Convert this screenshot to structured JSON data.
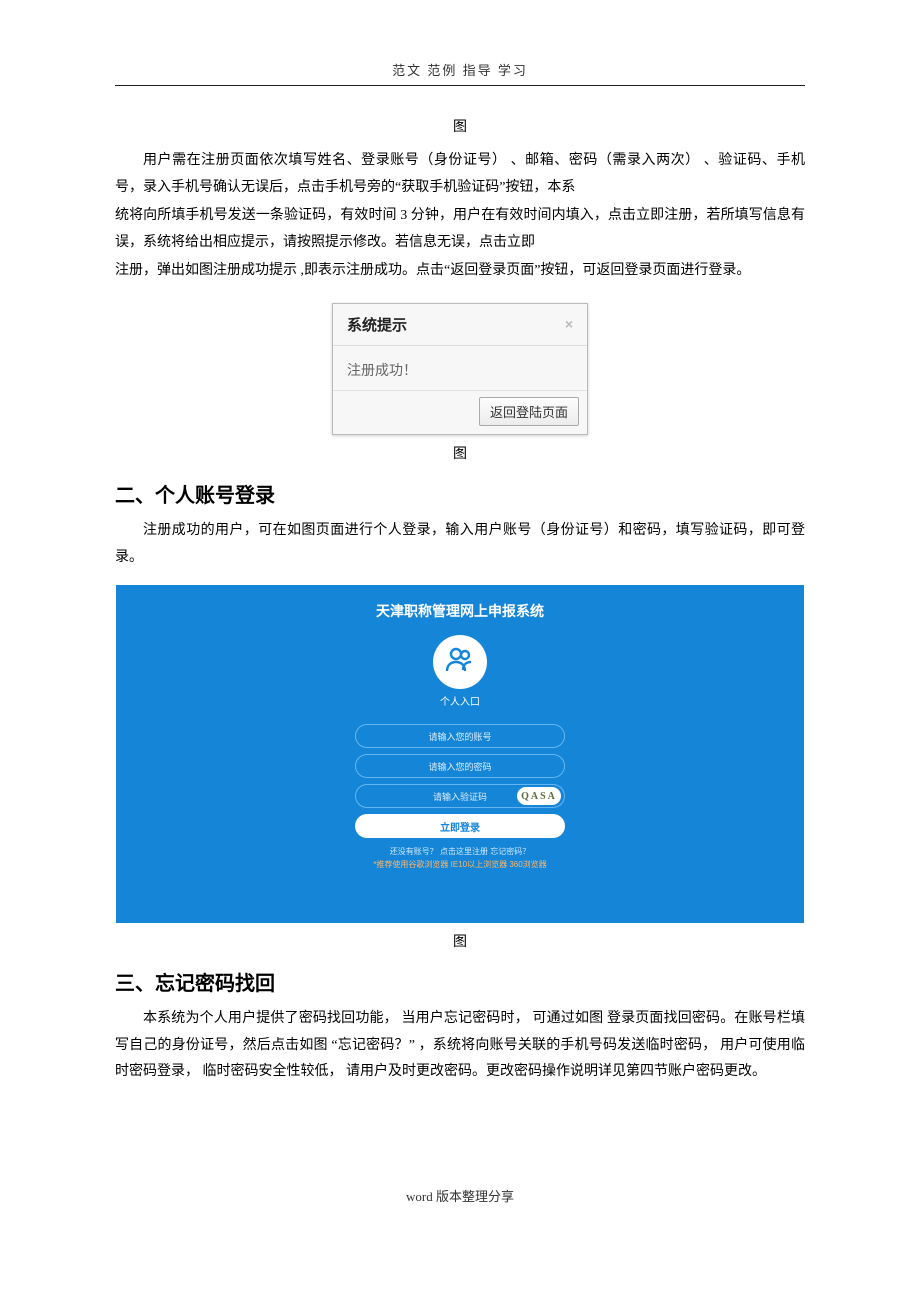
{
  "header": {
    "text": "范文   范例   指导   学习"
  },
  "fig1": {
    "caption": "图"
  },
  "para1": "用户需在注册页面依次填写姓名、登录账号（身份证号） 、邮箱、密码（需录入两次） 、验证码、手机号，录入手机号确认无误后，点击手机号旁的“获取手机验证码”按钮，本系",
  "para2a": "统将向所填手机号发送一条验证码，有效时间 3 分钟，用户在有效时间内填入，点击立即注册，若所填写信息有误，系统将给出相应提示，请按照提示修改。若信息无误，点击立即",
  "para2b": "注册，弹出如图注册成功提示 ,即表示注册成功。点击“返回登录页面”按钮，可返回登录页面进行登录。",
  "modal": {
    "title": "系统提示",
    "body": "注册成功！",
    "button": "返回登陆页面"
  },
  "fig2": {
    "caption": "图"
  },
  "section2": "二、个人账号登录",
  "para3": "注册成功的用户，可在如图页面进行个人登录，输入用户账号（身份证号）和密码，填写验证码，即可登录。",
  "login": {
    "title": "天津职称管理网上申报系统",
    "entry": "个人入口",
    "account_ph": "请输入您的账号",
    "password_ph": "请输入您的密码",
    "captcha_ph": "请输入验证码",
    "captcha_text": "QASA",
    "submit": "立即登录",
    "links1": "还没有账号？ 点击这里注册   忘记密码？",
    "links2": "*推荐使用谷歌浏览器 IE10以上浏览器 360浏览器"
  },
  "fig3": {
    "caption": "图"
  },
  "section3": "三、忘记密码找回",
  "para4": "本系统为个人用户提供了密码找回功能，      当用户忘记密码时，   可通过如图   登录页面找回密码。在账号栏填写自己的身份证号，然后点击如图            “忘记密码？” ，系统将向账号关联的手机号码发送临时密码，      用户可使用临时密码登录，   临时密码安全性较低，   请用户及时更改密码。更改密码操作说明详见第四节账户密码更改。",
  "footer": "word 版本整理分享"
}
